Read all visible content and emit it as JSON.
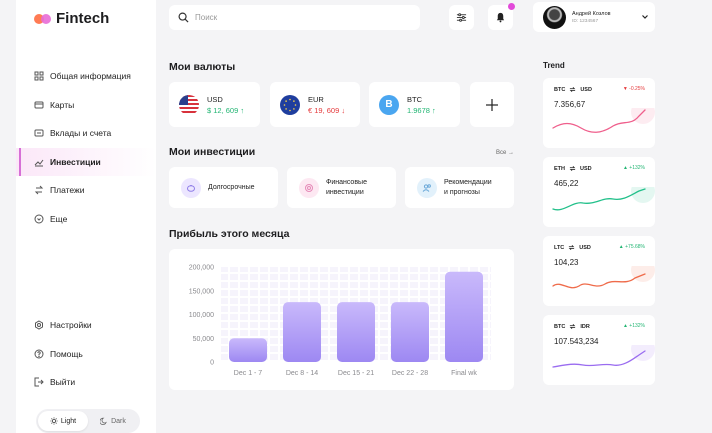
{
  "brand": {
    "name": "Fintech"
  },
  "sidebar": {
    "items": [
      {
        "label": "Общая информация",
        "icon": "grid-icon"
      },
      {
        "label": "Карты",
        "icon": "card-icon"
      },
      {
        "label": "Вклады и счета",
        "icon": "wallet-icon"
      },
      {
        "label": "Инвестиции",
        "icon": "chart-line-icon",
        "active": true
      },
      {
        "label": "Платежи",
        "icon": "transfer-icon"
      },
      {
        "label": "Еще",
        "icon": "more-icon"
      }
    ],
    "bottom": [
      {
        "label": "Настройки",
        "icon": "gear-icon"
      },
      {
        "label": "Помощь",
        "icon": "help-icon"
      },
      {
        "label": "Выйти",
        "icon": "logout-icon"
      }
    ],
    "theme": {
      "light": "Light",
      "dark": "Dark",
      "selected": "Light"
    }
  },
  "search": {
    "placeholder": "Поиск"
  },
  "user": {
    "name": "Андрей Козлов",
    "id": "ID: 1234567"
  },
  "currencies": {
    "title": "Мои валюты",
    "items": [
      {
        "code": "USD",
        "amount": "$ 12, 609",
        "trend": "up",
        "arrow": "↑"
      },
      {
        "code": "EUR",
        "amount": "€ 19, 609",
        "trend": "down",
        "arrow": "↓"
      },
      {
        "code": "BTC",
        "amount": "1.9678",
        "trend": "up",
        "arrow": "↑"
      }
    ]
  },
  "investments": {
    "title": "Мои инвестиции",
    "see_all": "Все →",
    "items": [
      {
        "line1": "Долгосрочные",
        "line2": ""
      },
      {
        "line1": "Финансовые",
        "line2": "инвестиции"
      },
      {
        "line1": "Рекомендации",
        "line2": "и прогнозы"
      }
    ]
  },
  "profit": {
    "title": "Прибыль этого месяца"
  },
  "chart_data": {
    "type": "bar",
    "categories": [
      "Dec 1 - 7",
      "Dec 8 - 14",
      "Dec 15 - 21",
      "Dec 22 - 28",
      "Final wk"
    ],
    "values": [
      50000,
      126000,
      126000,
      126000,
      190000
    ],
    "yticks": [
      "200,000",
      "150,000",
      "100,000",
      "50,000",
      "0"
    ],
    "ylim": [
      0,
      200000
    ],
    "colors": {
      "bar_top": "#c7b8fb",
      "bar_bottom": "#9a86f0"
    }
  },
  "trend": {
    "title": "Trend",
    "cards": [
      {
        "from": "BTC",
        "to": "USD",
        "change": "▼ -0.25%",
        "dir": "down",
        "value": "7.356,67",
        "color": "#ef5f8c"
      },
      {
        "from": "ETH",
        "to": "USD",
        "change": "▲ +132%",
        "dir": "up",
        "value": "465,22",
        "color": "#22c08a"
      },
      {
        "from": "LTC",
        "to": "USD",
        "change": "▲ +75.68%",
        "dir": "up",
        "value": "104,23",
        "color": "#ef6b4a"
      },
      {
        "from": "BTC",
        "to": "IDR",
        "change": "▲ +132%",
        "dir": "up",
        "value": "107.543,234",
        "color": "#9a6cf0"
      }
    ]
  }
}
